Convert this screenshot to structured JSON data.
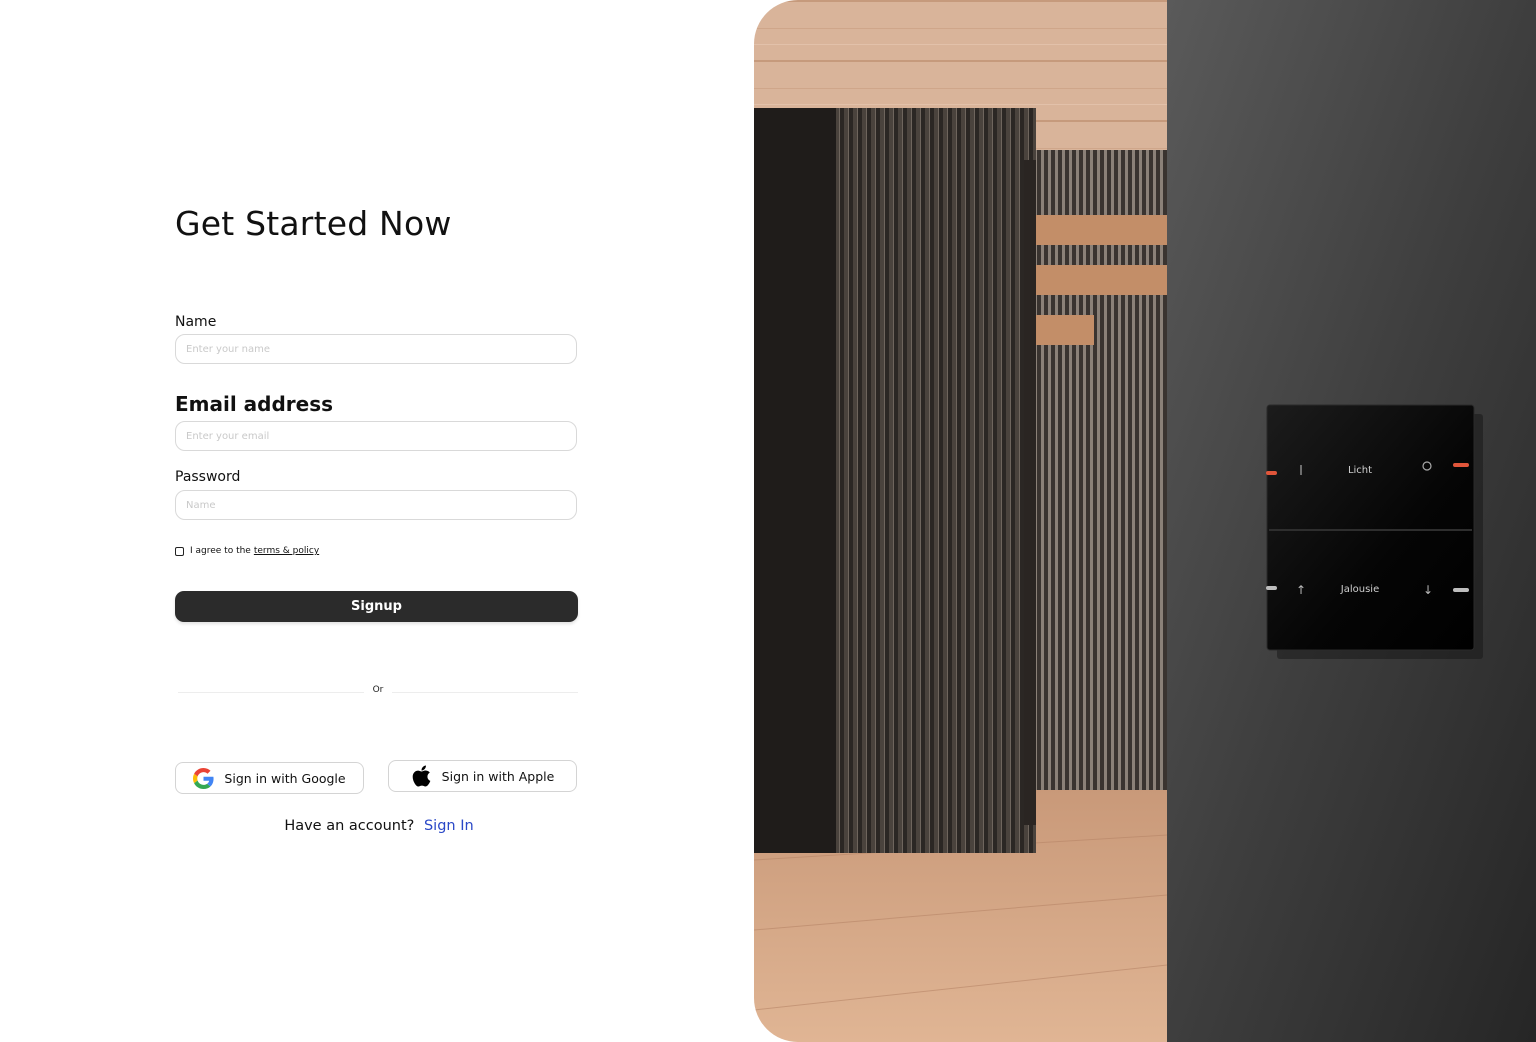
{
  "title": "Get Started Now",
  "form": {
    "name_label": "Name",
    "name_placeholder": "Enter your name",
    "email_label": "Email address",
    "email_placeholder": "Enter your email",
    "password_label": "Password",
    "password_placeholder": "Name",
    "agree_text": "I agree to the",
    "terms_link": "terms & policy",
    "signup_label": "Signup"
  },
  "divider_text": "Or",
  "social": {
    "google_label": "Sign in with Google",
    "google_icon": "google-icon",
    "apple_label": "Sign in with Apple",
    "apple_icon": "apple-icon"
  },
  "footer": {
    "prompt": "Have an account?",
    "signin_link": "Sign In",
    "link_color": "#2a48c7"
  },
  "hero": {
    "switch_top_label": "Licht",
    "switch_bottom_label": "Jalousie",
    "indicator_color": "#e0553a"
  }
}
